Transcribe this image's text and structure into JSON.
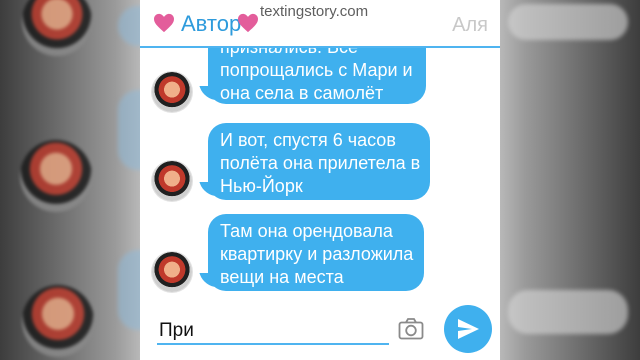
{
  "header": {
    "title": "Автор",
    "watermark": "textingstory.com",
    "contact_name": "Аля"
  },
  "messages": [
    {
      "sender": "Автор",
      "lines": [
        "признались. Все",
        "попрощались с Мари и",
        "она села в самолёт"
      ]
    },
    {
      "sender": "Автор",
      "lines": [
        "И вот, спустя 6 часов",
        "полёта она прилетела в",
        "Нью-Йорк"
      ]
    },
    {
      "sender": "Автор",
      "lines": [
        "Там она орендовала",
        "квартирку и разложила",
        "вещи на места"
      ]
    }
  ],
  "composer": {
    "input_value": "При"
  },
  "colors": {
    "accent": "#3fb0ee",
    "heart": "#e35d9b",
    "title": "#2e9bdc"
  },
  "icons": {
    "heart": "heart-icon",
    "camera": "camera-icon",
    "send": "send-icon"
  }
}
